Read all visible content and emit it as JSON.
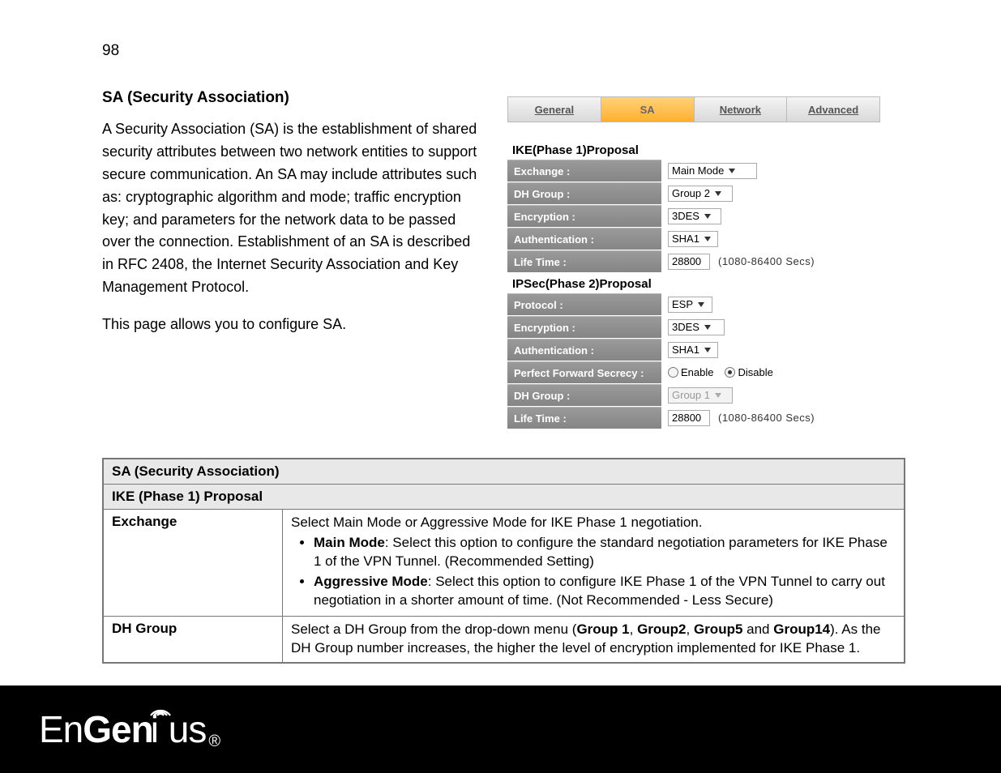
{
  "page_number": "98",
  "heading": "SA (Security Association)",
  "para1": "A Security Association (SA) is the establishment of shared security attributes between two network entities to support secure communication. An SA may include attributes such as: cryptographic algorithm and mode; traffic encryption key; and parameters for the network data to be passed over the connection. Establishment of an SA is described in RFC 2408, the Internet Security Association and Key Management Protocol.",
  "para2": "This page allows you to configure SA.",
  "config_panel": {
    "tabs": {
      "general": "General",
      "sa": "SA",
      "network": "Network",
      "advanced": "Advanced"
    },
    "ike_title": "IKE(Phase 1)Proposal",
    "ipsec_title": "IPSec(Phase 2)Proposal",
    "ike": {
      "exchange": {
        "label": "Exchange :",
        "value": "Main Mode"
      },
      "dh_group": {
        "label": "DH Group :",
        "value": "Group 2"
      },
      "encryption": {
        "label": "Encryption :",
        "value": "3DES"
      },
      "authentication": {
        "label": "Authentication :",
        "value": "SHA1"
      },
      "life_time": {
        "label": "Life Time :",
        "value": "28800",
        "hint": "(1080-86400 Secs)"
      }
    },
    "ipsec": {
      "protocol": {
        "label": "Protocol :",
        "value": "ESP"
      },
      "encryption": {
        "label": "Encryption :",
        "value": "3DES"
      },
      "authentication": {
        "label": "Authentication :",
        "value": "SHA1"
      },
      "pfs": {
        "label": "Perfect Forward Secrecy :",
        "enable": "Enable",
        "disable": "Disable",
        "selected": "disable"
      },
      "dh_group": {
        "label": "DH Group :",
        "value": "Group 1"
      },
      "life_time": {
        "label": "Life Time :",
        "value": "28800",
        "hint": "(1080-86400 Secs)"
      }
    }
  },
  "table": {
    "header1": "SA (Security Association)",
    "header2": "IKE (Phase 1) Proposal",
    "rows": {
      "exchange": {
        "key": "Exchange",
        "intro": "Select Main Mode or Aggressive Mode for IKE Phase 1 negotiation.",
        "main_mode_label": "Main Mode",
        "main_mode_text": ": Select this option to configure the standard negotiation parameters for IKE Phase 1 of  the VPN Tunnel. (Recommended Setting)",
        "aggressive_label": "Aggressive Mode",
        "aggressive_text": ": Select this option to configure IKE Phase 1 of the VPN Tunnel to carry out negotiation in a shorter amount of time. (Not Recommended - Less Secure)"
      },
      "dh_group": {
        "key": "DH Group",
        "pre": "Select a DH Group from the drop-down menu (",
        "b1": "Group 1",
        "c1": ", ",
        "b2": "Group2",
        "c2": ", ",
        "b3": "Group5",
        "c3": " and ",
        "b4": "Group14",
        "post": "). As the DH Group number increases, the higher the level of encryption implemented for IKE Phase 1."
      }
    }
  },
  "brand": {
    "name_part1": "En",
    "name_part2": "Gen",
    "name_part3": "us",
    "reg": "®"
  }
}
